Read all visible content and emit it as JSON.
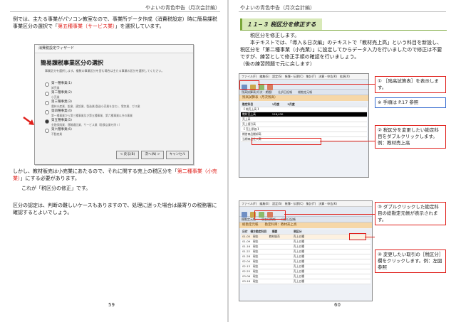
{
  "header": "やよいの青色申告（月次会計編）",
  "left": {
    "para1": "例では、主たる事業がパソコン教室なので、事業所データ作成（消費税設定）時に簡易課税事業区分の選択で「",
    "para1_red": "第五種事業（サービス業）",
    "para1_end": "」を選択しています。",
    "dialog": {
      "title": "消費税設定ウィザード",
      "heading": "簡易課税事業区分の選択",
      "desc": "事業区分を選択します。複数の事業区分を営む場合は主たる事業の区分を選択してください。",
      "options": [
        {
          "label": "第一種事業(1)",
          "sub": "卸売業",
          "selected": false
        },
        {
          "label": "第二種事業(2)",
          "sub": "小売業",
          "selected": false
        },
        {
          "label": "第三種事業(3)",
          "sub": "農林水産業、鉱業、建設業、製造業(製造小売業を含む)、電気業、ガス業",
          "selected": false
        },
        {
          "label": "第四種事業(4)",
          "sub": "第一種事業から第三種事業及び第五種事業、第六種事業以外の事業",
          "selected": false
        },
        {
          "label": "第五種事業(5)",
          "sub": "金融保険業、運輸通信業、サービス業（飲食店業を除く）",
          "selected": true
        },
        {
          "label": "第六種事業(6)",
          "sub": "不動産業",
          "selected": false
        }
      ],
      "buttons": [
        "< 戻る(B)",
        "次へ(N) >",
        "キャンセル"
      ]
    },
    "para2a": "しかし、教材販売は小売業にあたるので、それに関する売上の税区分を「",
    "para2_red": "第二種事業（小売業）",
    "para2_end": "」にする必要があります。",
    "para3": "これが「税区分の修正」です。",
    "para4": "区分の認定は、判断の難しいケースもありますので、処理に迷った場合は最寄りの税務署に確認するとよいでしょう。",
    "page_number": "59"
  },
  "right": {
    "section_title": "１１−３ 税区分を修正する",
    "intro": [
      "税区分を修正します。",
      "本テキストでは、「導入＆日次編」のテキストで「教材売上高」という科目を新設し、税区分を「第二種事業（小売業）」に設定してからデータ入力を行いましたので修正は不要ですが、練習として修正手順の確認を行いましょう。",
      "（後の練習問題で元に戻します）"
    ],
    "shot1": {
      "menu": "ファイル(F)　編集(E)　設定(S)　帳簿・伝票(C)　集計(T)　決算・申告(K)　拡張(X)",
      "tabs": "残高試算表(月次・期間)　　仕訳日記帳　　総勘定元帳",
      "subhead": "残高試算表（月次残高）",
      "rows": [
        "勘定科目　　　　　　　1月度　　　2月度",
        "【 純売上高 】",
        "教材売上高　　　　　　128,430",
        "売上高　　　　　　　　",
        "売上値引高",
        "【 売上原価 】",
        "期首商品棚卸高",
        "当期商品仕入高"
      ]
    },
    "shot2": {
      "menu": "ファイル(F)　編集(E)　設定(S)　帳簿・伝票(C)　集計(T)　決算・申告(K)",
      "tabs": "総勘定元帳　　現金出納帳　　仕訳日記帳",
      "subhead": "総勘定元帳　　勘定科目：教材売上高",
      "rows": [
        "日付　借方勘定科目　　摘要　　　　　　税区分",
        "01-05　現金　　　　教材販売　　　　　売上五種",
        "01-09　現金　　　　　　　　　　　　　売上五種",
        "01-16　現金　　　　　　　　　　　　　売上五種",
        "01-22　現金　　　　　　　　　　　　　売上五種",
        "01-28　現金　　　　　　　　　　　　　売上五種",
        "02-04　現金　　　　　　　　　　　　　売上五種",
        "02-13　現金　　　　　　　　　　　　　売上五種",
        "02-25　現金　　　　　　　　　　　　　売上五種",
        "03-06　現金　　　　　　　　　　　　　売上五種",
        "03-18　現金　　　　　　　　　　　　　売上五種"
      ]
    },
    "callouts": {
      "c1": "① ［残高試算表］を表示します。",
      "c2": "※ 手順は P.17 参照",
      "c3": "② 税区分を変更したい勘定科目をダブルクリックします。例：教材売上高",
      "c4": "③ ダブルクリックした勘定科目の総勘定元帳が表示されます。",
      "c5": "④ 変更したい取引の［税区分］欄をクリックします。例：左図参照"
    },
    "page_number": "60"
  },
  "colors": {
    "accent_red": "#e0201b",
    "section_green": "#d8e9b8",
    "note_blue": "#3b6fd1"
  }
}
